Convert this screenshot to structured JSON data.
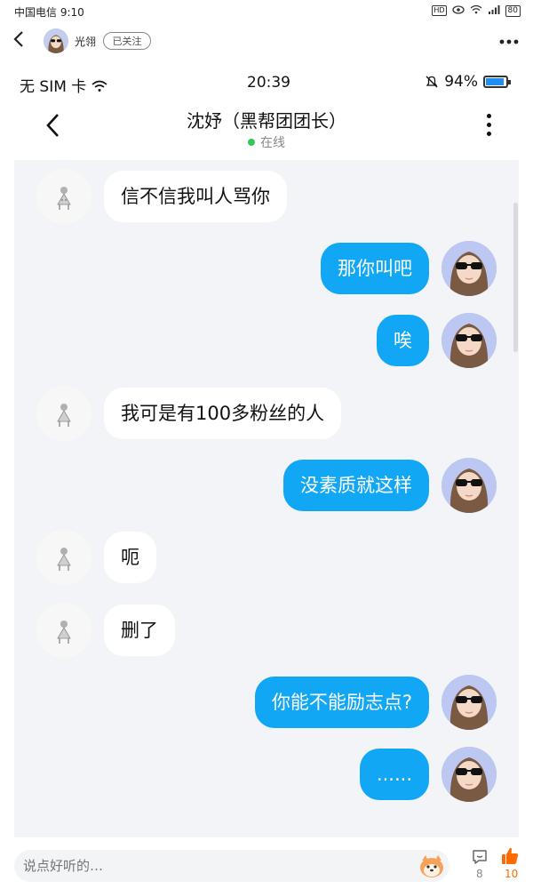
{
  "outer_status": {
    "carrier": "中国电信 9:10",
    "hd": "HD",
    "battery": "80"
  },
  "app_header": {
    "username": "光翎",
    "follow_label": "已关注",
    "more_icon": "more-dots-icon"
  },
  "inner_status": {
    "left": "无 SIM 卡",
    "time": "20:39",
    "battery": "94%"
  },
  "chat_header": {
    "title": "沈妤（黑帮团团长）",
    "status": "在线"
  },
  "messages": [
    {
      "side": "in",
      "text": "信不信我叫人骂你"
    },
    {
      "side": "out",
      "text": "那你叫吧"
    },
    {
      "side": "out",
      "text": "唉"
    },
    {
      "side": "in",
      "text": "我可是有100多粉丝的人"
    },
    {
      "side": "out",
      "text": "没素质就这样"
    },
    {
      "side": "in",
      "text": "呃"
    },
    {
      "side": "in",
      "text": "删了"
    },
    {
      "side": "out",
      "text": "你能不能励志点?"
    },
    {
      "side": "out",
      "text": "......"
    }
  ],
  "bottom_bar": {
    "placeholder": "说点好听的…",
    "comment_count": "8",
    "like_count": "10"
  },
  "colors": {
    "accent": "#12a7f5",
    "like": "#ff6a00",
    "online": "#35c759"
  }
}
